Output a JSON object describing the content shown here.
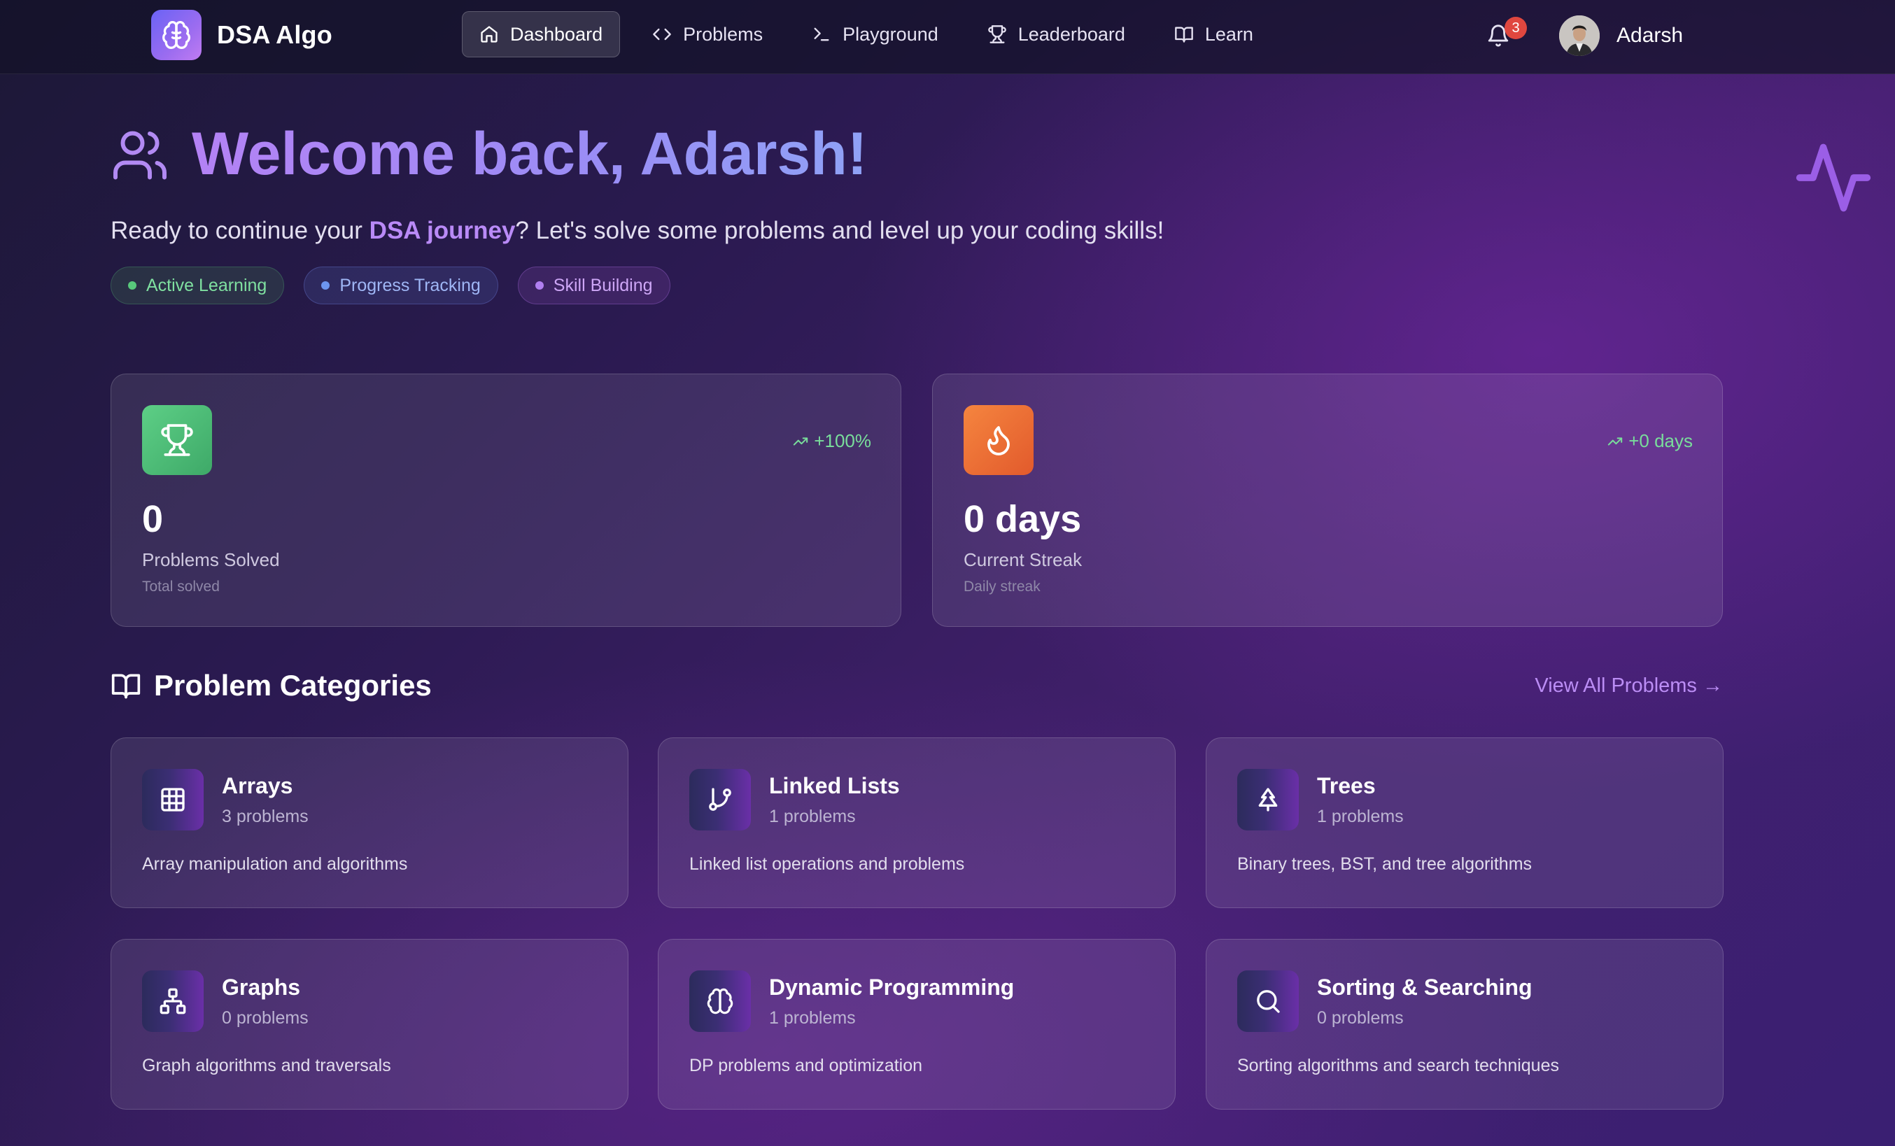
{
  "app": {
    "name": "DSA Algo",
    "logo_icon": "brain-icon"
  },
  "nav": {
    "items": [
      {
        "label": "Dashboard",
        "icon": "home-icon",
        "active": true
      },
      {
        "label": "Problems",
        "icon": "code-icon",
        "active": false
      },
      {
        "label": "Playground",
        "icon": "terminal-icon",
        "active": false
      },
      {
        "label": "Leaderboard",
        "icon": "trophy-icon",
        "active": false
      },
      {
        "label": "Learn",
        "icon": "book-icon",
        "active": false
      }
    ],
    "notifications_count": "3",
    "user_name": "Adarsh"
  },
  "hero": {
    "title": "Welcome back, Adarsh!",
    "subtitle_pre": "Ready to continue your ",
    "subtitle_highlight": "DSA journey",
    "subtitle_post": "? Let's solve some problems and level up your coding skills!",
    "pills": [
      {
        "label": "Active Learning",
        "color": "#58c97b"
      },
      {
        "label": "Progress Tracking",
        "color": "#6d95ef"
      },
      {
        "label": "Skill Building",
        "color": "#b07ff0"
      }
    ]
  },
  "stats": [
    {
      "icon": "trophy-icon",
      "trend": "+100%",
      "value": "0",
      "label": "Problems Solved",
      "sub": "Total solved",
      "accent": "#4cbf77"
    },
    {
      "icon": "flame-icon",
      "trend": "+0 days",
      "value": "0 days",
      "label": "Current Streak",
      "sub": "Daily streak",
      "accent": "#ee6f35"
    }
  ],
  "categories_section": {
    "title": "Problem Categories",
    "view_all": "View All Problems →"
  },
  "categories": [
    {
      "name": "Arrays",
      "count": "3 problems",
      "desc": "Array manipulation and algorithms",
      "icon": "grid-icon"
    },
    {
      "name": "Linked Lists",
      "count": "1 problems",
      "desc": "Linked list operations and problems",
      "icon": "git-branch-icon"
    },
    {
      "name": "Trees",
      "count": "1 problems",
      "desc": "Binary trees, BST, and tree algorithms",
      "icon": "tree-icon"
    },
    {
      "name": "Graphs",
      "count": "0 problems",
      "desc": "Graph algorithms and traversals",
      "icon": "network-icon"
    },
    {
      "name": "Dynamic Programming",
      "count": "1 problems",
      "desc": "DP problems and optimization",
      "icon": "brain-icon"
    },
    {
      "name": "Sorting & Searching",
      "count": "0 problems",
      "desc": "Sorting algorithms and search techniques",
      "icon": "search-icon"
    }
  ],
  "colors": {
    "accent_purple": "#b98af7",
    "trend_green": "#79dd9b",
    "badge_red": "#e0473f"
  }
}
